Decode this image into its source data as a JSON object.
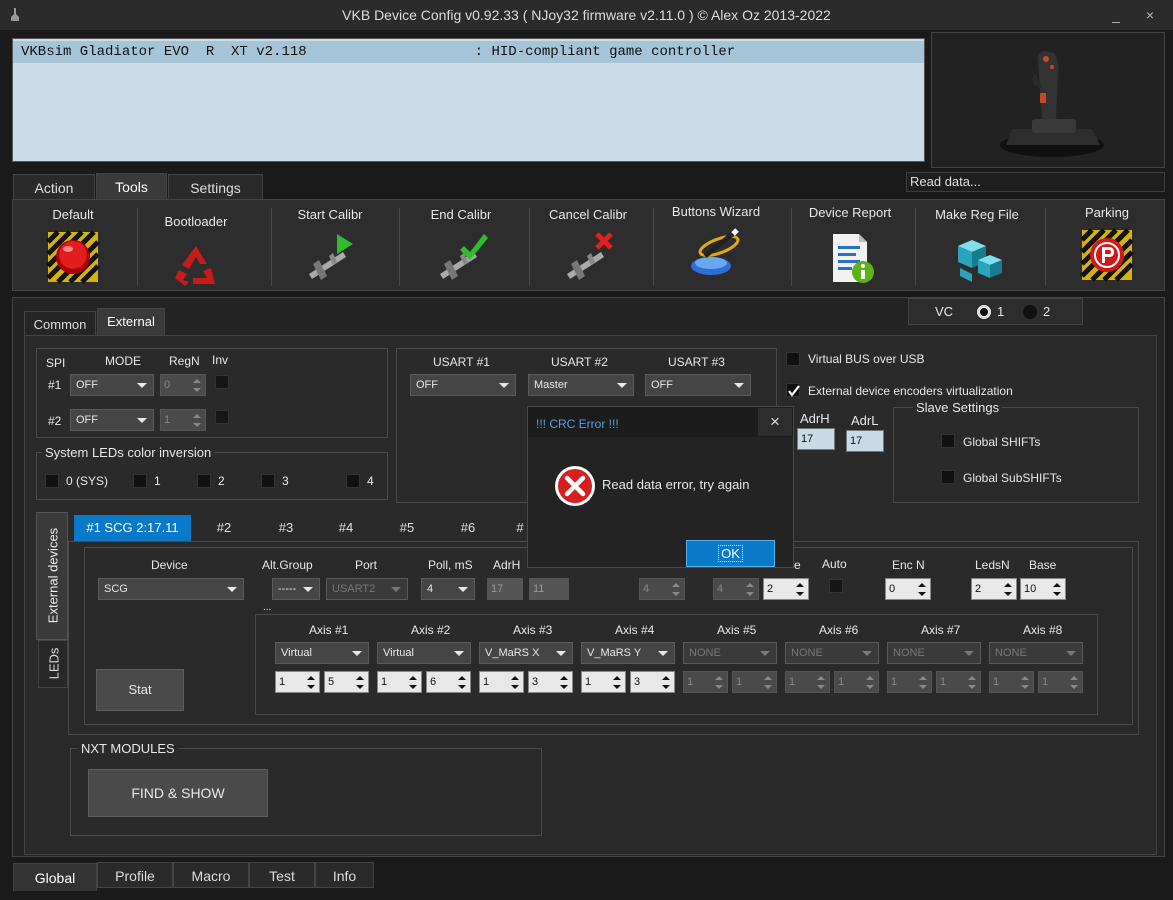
{
  "window": {
    "title": "VKB Device Config v0.92.33 ( NJoy32 firmware v2.11.0 ) © Alex Oz 2013-2022",
    "minimize": "_",
    "close": "×"
  },
  "device_list": {
    "row": "VKBsim Gladiator EVO  R  XT v2.118                    : HID-compliant game controller"
  },
  "status": "Read data...",
  "main_tabs": [
    "Action",
    "Tools",
    "Settings"
  ],
  "tools": [
    "Default",
    "Bootloader",
    "Start Calibr",
    "End Calibr",
    "Cancel Calibr",
    "Buttons Wizard",
    "Device Report",
    "Make Reg File",
    "Parking"
  ],
  "sub_tabs": [
    "Common",
    "External"
  ],
  "vc": {
    "label": "VC",
    "opt1": "1",
    "opt2": "2"
  },
  "spi": {
    "headers": {
      "spi": "SPI",
      "mode": "MODE",
      "regn": "RegN",
      "inv": "Inv"
    },
    "rows": [
      {
        "label": "#1",
        "mode": "OFF",
        "regn": "0"
      },
      {
        "label": "#2",
        "mode": "OFF",
        "regn": "1"
      }
    ]
  },
  "leds_inversion": {
    "title": "System LEDs color inversion",
    "items": [
      "0 (SYS)",
      "1",
      "2",
      "3",
      "4"
    ]
  },
  "usart": {
    "headers": [
      "USART #1",
      "USART #2",
      "USART #3"
    ],
    "values": [
      "OFF",
      "Master",
      "OFF"
    ]
  },
  "options": {
    "virtual_bus": "Virtual BUS over USB",
    "ext_encoders": "External device encoders virtualization"
  },
  "addr": {
    "adrh_label": "AdrH",
    "adrl_label": "AdrL",
    "adrh": "17",
    "adrl": "17"
  },
  "slave": {
    "title": "Slave Settings",
    "global_shifts": "Global SHIFTs",
    "global_subshifts": "Global SubSHIFTs"
  },
  "side_tabs": [
    "External devices",
    "LEDs"
  ],
  "scg_tabs": [
    "#1 SCG 2:17.11",
    "#2",
    "#3",
    "#4",
    "#5",
    "#6",
    "#"
  ],
  "device": {
    "labels": {
      "device": "Device",
      "altgroup": "Alt.Group",
      "port": "Port",
      "poll": "Poll, mS",
      "adrh": "AdrH",
      "mode_tail": "e",
      "auto": "Auto",
      "encn": "Enc N",
      "ledsn": "LedsN",
      "base": "Base"
    },
    "device": "SCG",
    "altgroup": "-----",
    "port": "USART2",
    "poll": "4",
    "adrh": "17",
    "adrl": "11",
    "spin_a": "4",
    "spin_b": "4",
    "spin_c": "2",
    "encn": "0",
    "ledsn": "2",
    "base": "10",
    "ellipsis": "..."
  },
  "axes": [
    {
      "label": "Axis #1",
      "value": "Virtual",
      "a": "1",
      "b": "5",
      "enabled": true
    },
    {
      "label": "Axis #2",
      "value": "Virtual",
      "a": "1",
      "b": "6",
      "enabled": true
    },
    {
      "label": "Axis #3",
      "value": "V_MaRS X",
      "a": "1",
      "b": "3",
      "enabled": true
    },
    {
      "label": "Axis #4",
      "value": "V_MaRS Y",
      "a": "1",
      "b": "3",
      "enabled": true
    },
    {
      "label": "Axis #5",
      "value": "NONE",
      "a": "1",
      "b": "1",
      "enabled": false
    },
    {
      "label": "Axis #6",
      "value": "NONE",
      "a": "1",
      "b": "1",
      "enabled": false
    },
    {
      "label": "Axis #7",
      "value": "NONE",
      "a": "1",
      "b": "1",
      "enabled": false
    },
    {
      "label": "Axis #8",
      "value": "NONE",
      "a": "1",
      "b": "1",
      "enabled": false
    }
  ],
  "stat_button": "Stat",
  "nxt": {
    "title": "NXT MODULES",
    "button": "FIND & SHOW"
  },
  "bottom_tabs": [
    "Global",
    "Profile",
    "Macro",
    "Test",
    "Info"
  ],
  "dialog": {
    "title": "!!! CRC Error !!!",
    "message": "Read data error, try again",
    "ok": "OK",
    "close": "×"
  },
  "colors": {
    "accent": "#0a7ac8",
    "dialog_title": "#4fa3e0",
    "error_red": "#d62020"
  }
}
